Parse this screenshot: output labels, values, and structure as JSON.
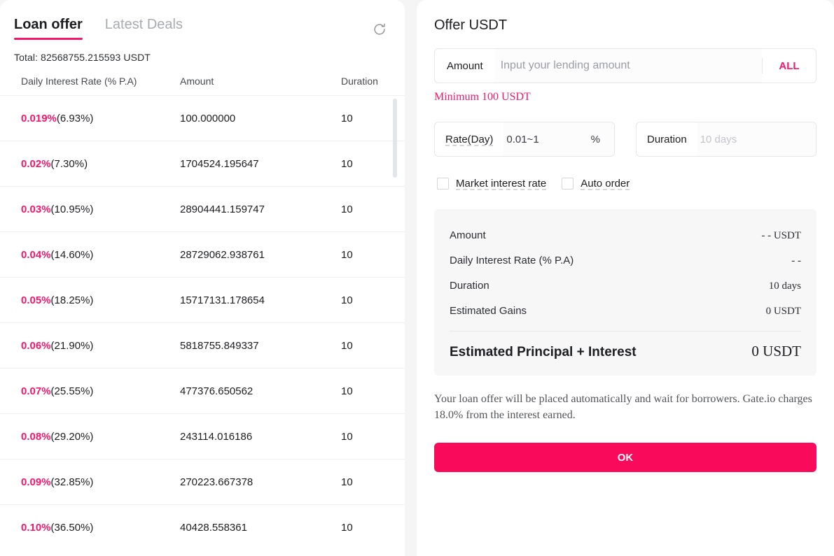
{
  "theme": {
    "accent_pink": "#f5176b",
    "button_pink": "#fa0a5a",
    "text_primary": "#1c1d21",
    "text_muted": "#a8abb2",
    "page_bg": "#f5f5f6"
  },
  "left_panel": {
    "tabs": [
      {
        "label": "Loan offer",
        "active": true
      },
      {
        "label": "Latest Deals",
        "active": false
      }
    ],
    "refresh_icon": "refresh-icon",
    "total_text": "Total: 82568755.215593 USDT",
    "columns": {
      "rate": "Daily Interest Rate (% P.A)",
      "amount": "Amount",
      "duration": "Duration"
    },
    "rows": [
      {
        "rate": "0.019%",
        "apr": "(6.93%)",
        "amount": "100.000000",
        "duration": "10"
      },
      {
        "rate": "0.02%",
        "apr": "(7.30%)",
        "amount": "1704524.195647",
        "duration": "10"
      },
      {
        "rate": "0.03%",
        "apr": "(10.95%)",
        "amount": "28904441.159747",
        "duration": "10"
      },
      {
        "rate": "0.04%",
        "apr": "(14.60%)",
        "amount": "28729062.938761",
        "duration": "10"
      },
      {
        "rate": "0.05%",
        "apr": "(18.25%)",
        "amount": "15717131.178654",
        "duration": "10"
      },
      {
        "rate": "0.06%",
        "apr": "(21.90%)",
        "amount": "5818755.849337",
        "duration": "10"
      },
      {
        "rate": "0.07%",
        "apr": "(25.55%)",
        "amount": "477376.650562",
        "duration": "10"
      },
      {
        "rate": "0.08%",
        "apr": "(29.20%)",
        "amount": "243114.016186",
        "duration": "10"
      },
      {
        "rate": "0.09%",
        "apr": "(32.85%)",
        "amount": "270223.667378",
        "duration": "10"
      },
      {
        "rate": "0.10%",
        "apr": "(36.50%)",
        "amount": "40428.558361",
        "duration": "10"
      }
    ]
  },
  "right_panel": {
    "title": "Offer USDT",
    "amount_field": {
      "label": "Amount",
      "value": "",
      "placeholder": "Input your lending amount",
      "all_label": "ALL"
    },
    "min_note": "Minimum 100 USDT",
    "rate_field": {
      "label": "Rate(Day)",
      "value": "0.01~1",
      "placeholder": "0.01~1",
      "suffix": "%"
    },
    "duration_field": {
      "label": "Duration",
      "value": "",
      "placeholder": "10 days"
    },
    "checkboxes": [
      {
        "label": "Market interest rate",
        "checked": false
      },
      {
        "label": "Auto order",
        "checked": false
      }
    ],
    "summary": {
      "rows": [
        {
          "label": "Amount",
          "value": "- - USDT"
        },
        {
          "label": "Daily Interest Rate (% P.A)",
          "value": "- -"
        },
        {
          "label": "Duration",
          "value": "10 days"
        },
        {
          "label": "Estimated Gains",
          "value": "0 USDT"
        }
      ],
      "total_label": "Estimated Principal + Interest",
      "total_value": "0 USDT"
    },
    "footnote": "Your loan offer will be placed automatically and wait for borrowers. Gate.io charges 18.0% from the interest earned.",
    "submit_label": "OK"
  }
}
